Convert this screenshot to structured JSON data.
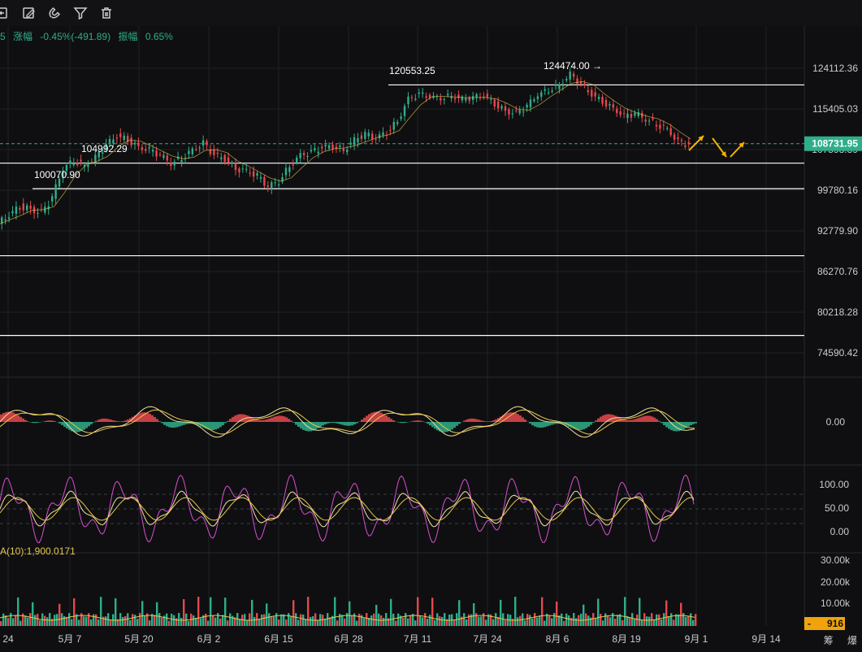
{
  "toolbar": {
    "icons": [
      "undo-icon",
      "edit-icon",
      "magnet-icon",
      "filter-icon",
      "trash-icon"
    ]
  },
  "stats": {
    "prefix": "5",
    "change_label": "涨幅",
    "change_value": "-0.45%(-491.89)",
    "amplitude_label": "振幅",
    "amplitude_value": "0.65%"
  },
  "colors": {
    "up": "#2fae8a",
    "down": "#e5484d",
    "grid": "#1e2024",
    "level_line": "#ffffff",
    "current_price_bg": "#2fae8a",
    "arrow": "#f5b400",
    "volume_tag_bg": "#f0a30a",
    "macd_line": "#f2e0a0",
    "signal_line": "#e8c84a",
    "kdj_j": "#d94fd1"
  },
  "chart_data": {
    "type": "line",
    "title": "",
    "x_tick_labels": [
      "24",
      "5月 7",
      "5月 20",
      "6月 2",
      "6月 15",
      "6月 28",
      "7月 11",
      "7月 24",
      "8月 6",
      "8月 19",
      "9月 1",
      "9月 14"
    ],
    "price_axis_labels": [
      "124112.36",
      "115405.03",
      "107598.39",
      "99780.16",
      "92779.90",
      "86270.76",
      "80218.28",
      "74590.42"
    ],
    "series": [
      {
        "values": [
          94000,
          95500,
          97000,
          96500,
          95800,
          98500,
          104000,
          105500,
          104500,
          106000,
          108500,
          110200,
          109500,
          108000,
          107500,
          106500,
          105000,
          106000,
          107500,
          108800,
          106500,
          105800,
          104000,
          103500,
          102500,
          100500,
          101500,
          104500,
          106500,
          107000,
          108000,
          108300,
          107500,
          109500,
          110500,
          109800,
          111000,
          113000,
          117500,
          118500,
          118000,
          117800,
          118200,
          117500,
          117800,
          118300,
          116500,
          115000,
          114500,
          116000,
          118500,
          119500,
          120500,
          122800,
          120500,
          118500,
          117000,
          115500,
          114000,
          114500,
          113500,
          112500,
          111500,
          109000,
          108500
        ]
      }
    ],
    "annotations": [
      "120553.25",
      "124474.00 →",
      "104992.29",
      "100070.90"
    ],
    "horizontal_levels": [
      120553.25,
      104992.29,
      100070.9,
      88800,
      77000
    ],
    "current_price": "108731.95",
    "macd_axis_label": "0.00",
    "kdj_axis_labels": [
      "100.00",
      "50.00",
      "0.00"
    ],
    "volume_axis_labels": [
      "30.00k",
      "20.00k",
      "10.00k"
    ],
    "volume_current": "916",
    "volume_current_prefix": "-",
    "indicator_label": "A(10):1,900.0171"
  },
  "corner": {
    "label1": "筹",
    "label2": "爆"
  }
}
